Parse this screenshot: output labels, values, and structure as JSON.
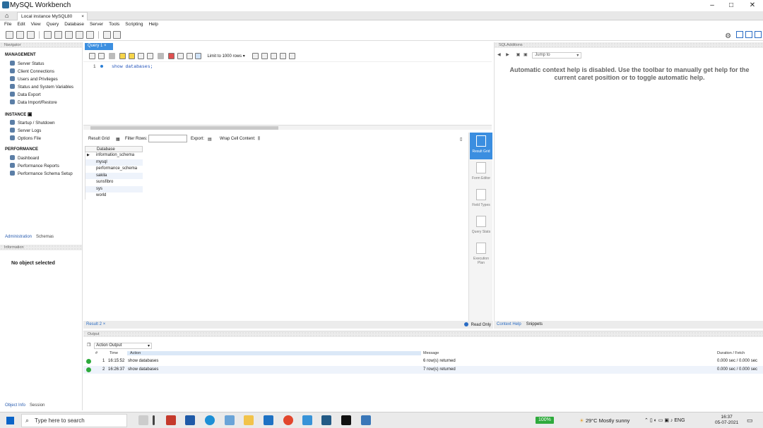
{
  "window": {
    "title": "MySQL Workbench",
    "min": "–",
    "max": "□",
    "close": "✕"
  },
  "connection_tab": {
    "label": "Local instance MySQL80",
    "close": "×"
  },
  "menu": [
    "File",
    "Edit",
    "View",
    "Query",
    "Database",
    "Server",
    "Tools",
    "Scripting",
    "Help"
  ],
  "navigator": {
    "header": "Navigator",
    "management_title": "MANAGEMENT",
    "management": [
      "Server Status",
      "Client Connections",
      "Users and Privileges",
      "Status and System Variables",
      "Data Export",
      "Data Import/Restore"
    ],
    "instance_title": "INSTANCE",
    "instance": [
      "Startup / Shutdown",
      "Server Logs",
      "Options File"
    ],
    "performance_title": "PERFORMANCE",
    "performance": [
      "Dashboard",
      "Performance Reports",
      "Performance Schema Setup"
    ],
    "tabs": [
      "Administration",
      "Schemas"
    ]
  },
  "information": {
    "header": "Information",
    "empty": "No object selected",
    "tabs": [
      "Object Info",
      "Session"
    ]
  },
  "query": {
    "tab_label": "Query 1",
    "tab_close": "×",
    "limit": "Limit to 1000 rows",
    "line_number": "1",
    "sql": "show databases;"
  },
  "result_toolbar": {
    "result_grid": "Result Grid",
    "filter_rows": "Filter Rows:",
    "export": "Export:",
    "wrap": "Wrap Cell Content:"
  },
  "grid": {
    "header": "Database",
    "rows": [
      "information_schema",
      "mysql",
      "performance_schema",
      "sakila",
      "sunsfibro",
      "sys",
      "world"
    ]
  },
  "result_side": [
    "Result Grid",
    "Form Editor",
    "Field Types",
    "Query Stats",
    "Execution Plan"
  ],
  "result_footer": {
    "tab": "Result 2",
    "close": "×",
    "readonly": "Read Only"
  },
  "sql_additions": {
    "header": "SQLAdditions",
    "jump_to": "Jump to",
    "help": "Automatic context help is disabled. Use the toolbar to manually get help for the current caret position or to toggle automatic help.",
    "tabs": [
      "Context Help",
      "Snippets"
    ]
  },
  "output": {
    "header": "Output",
    "selector": "Action Output",
    "columns": {
      "num": "#",
      "time": "Time",
      "action": "Action",
      "message": "Message",
      "duration": "Duration / Fetch"
    },
    "rows": [
      {
        "num": "1",
        "time": "16:15:52",
        "action": "show databases",
        "message": "6 row(s) returned",
        "duration": "0.000 sec / 0.000 sec"
      },
      {
        "num": "2",
        "time": "16:26:37",
        "action": "show databases",
        "message": "7 row(s) returned",
        "duration": "0.000 sec / 0.000 sec"
      }
    ]
  },
  "taskbar": {
    "search_placeholder": "Type here to search",
    "battery": "100%",
    "weather": "29°C  Mostly sunny",
    "lang": "ENG",
    "time": "16:37",
    "date": "05-07-2021"
  },
  "colors": {
    "accent": "#3b8ee0",
    "ok": "#2eaa3c",
    "link": "#2a6cc4"
  }
}
